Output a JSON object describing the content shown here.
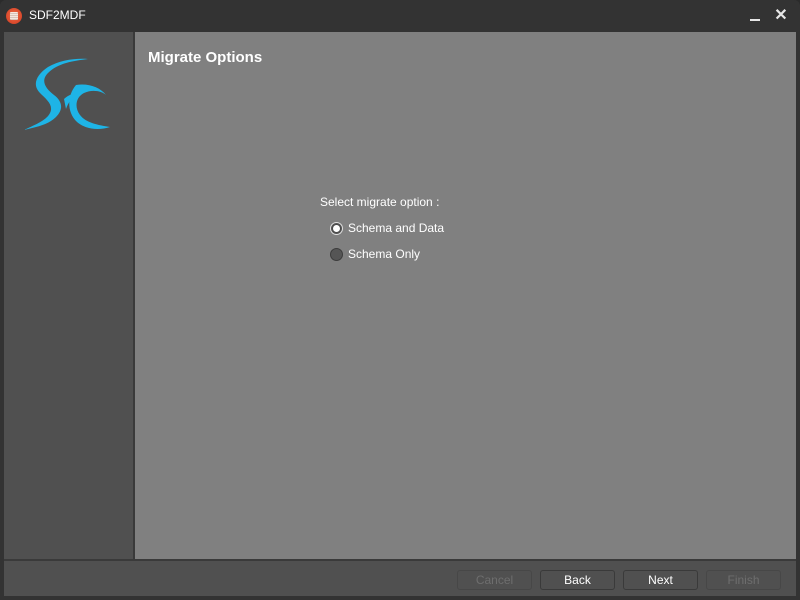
{
  "window": {
    "title": "SDF2MDF",
    "app_icon": "database-icon",
    "controls": {
      "minimize_icon": "minimize-icon",
      "close_icon": "close-icon",
      "close_glyph": "✕"
    }
  },
  "sidebar": {
    "logo": "sc-logo",
    "logo_text": "SC",
    "logo_color": "#1eb4e6"
  },
  "main": {
    "title": "Migrate Options",
    "prompt": "Select migrate option :",
    "options": [
      {
        "label": "Schema and Data",
        "selected": true
      },
      {
        "label": "Schema Only",
        "selected": false
      }
    ]
  },
  "footer": {
    "buttons": [
      {
        "label": "Cancel",
        "enabled": false
      },
      {
        "label": "Back",
        "enabled": true
      },
      {
        "label": "Next",
        "enabled": true
      },
      {
        "label": "Finish",
        "enabled": false
      }
    ]
  }
}
